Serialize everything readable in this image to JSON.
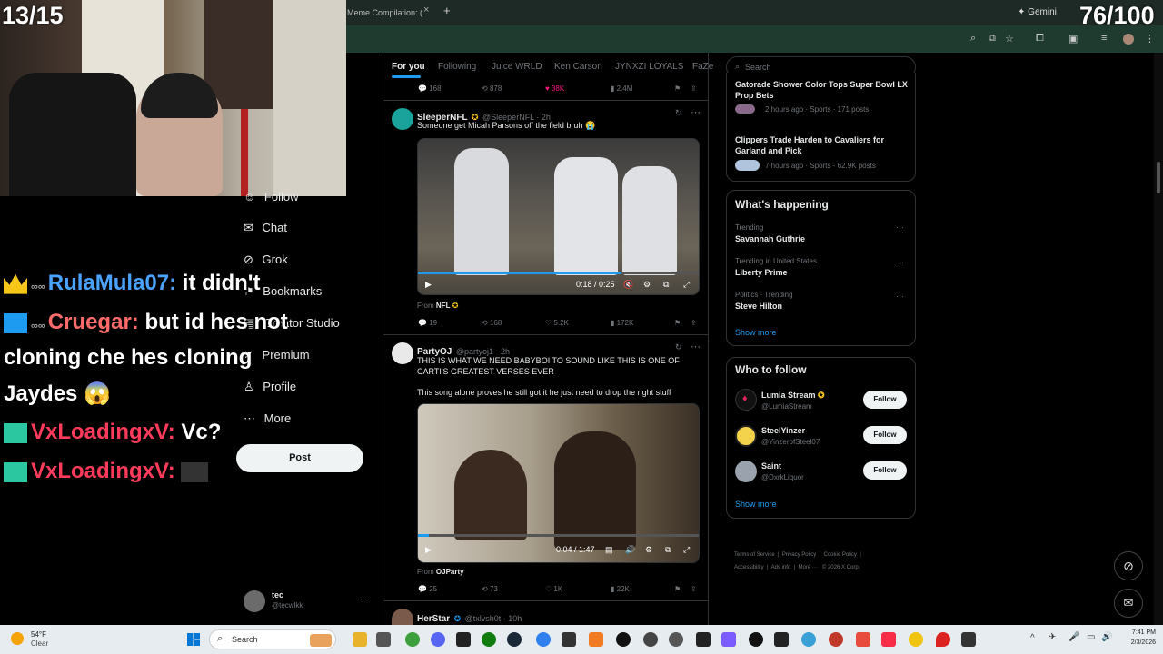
{
  "overlay": {
    "left_counter": "13/15",
    "right_counter": "76/100"
  },
  "browser": {
    "tab_title": "Meme Compilation: (",
    "tab_close": "×",
    "new_tab": "+",
    "gemini": "Gemini"
  },
  "left_nav": {
    "items": [
      {
        "label": "Follow",
        "icon": "follow-icon"
      },
      {
        "label": "Chat",
        "icon": "chat-icon"
      },
      {
        "label": "Grok",
        "icon": "grok-icon"
      },
      {
        "label": "Bookmarks",
        "icon": "bookmark-icon"
      },
      {
        "label": "Creator Studio",
        "icon": "studio-icon"
      },
      {
        "label": "Premium",
        "icon": "premium-icon"
      },
      {
        "label": "Profile",
        "icon": "profile-icon"
      },
      {
        "label": "More",
        "icon": "more-icon"
      }
    ],
    "post_label": "Post",
    "account": {
      "name": "tec",
      "handle": "@tecwlkk",
      "menu": "···"
    }
  },
  "chat": [
    {
      "user": "RulaMula07:",
      "message": "it didn't",
      "user_color": "#4aa3ff"
    },
    {
      "user": "Cruegar:",
      "message": "but id hes not",
      "user_color": "#ff6b6b"
    },
    {
      "continuation": "cloning che hes cloning"
    },
    {
      "continuation": "Jaydes 😱"
    },
    {
      "user": "VxLoadingxV:",
      "message": "Vc?",
      "user_color": "#ff3b5c"
    },
    {
      "user": "VxLoadingxV:",
      "message": "",
      "user_color": "#ff3b5c"
    }
  ],
  "timeline": {
    "tabs": [
      "For you",
      "Following",
      "Juice WRLD",
      "Ken Carson",
      "JYNXZI LOYALS",
      "FaZe"
    ],
    "top_stats": {
      "replies": "168",
      "reposts": "878",
      "likes": "38K",
      "views": "2.4M"
    },
    "posts": [
      {
        "name": "SleeperNFL",
        "handle": "@SleeperNFL · 2h",
        "text": "Someone get Micah Parsons off the field bruh 😭",
        "video_time": "0:18 / 0:25",
        "from_label": "From",
        "from": "NFL",
        "stats": {
          "replies": "19",
          "reposts": "168",
          "likes": "5.2K",
          "views": "172K"
        }
      },
      {
        "name": "PartyOJ",
        "handle": "@partyoj1 · 2h",
        "text": "THIS IS WHAT WE NEED BABYBOI TO SOUND LIKE THIS IS ONE OF CARTI'S GREATEST VERSES EVER",
        "text2": "This song alone proves he still got it he just need to drop the right stuff",
        "video_time": "0:04 / 1:47",
        "from_label": "From",
        "from": "OJParty",
        "stats": {
          "replies": "25",
          "reposts": "73",
          "likes": "1K",
          "views": "22K"
        }
      },
      {
        "name": "HerStar",
        "handle": "@txlvsh0t · 10h"
      }
    ]
  },
  "sidebar": {
    "search_placeholder": "Search",
    "news": [
      {
        "title": "Gatorade Shower Color Tops Super Bowl LX Prop Bets",
        "meta": "2 hours ago · Sports · 171 posts"
      },
      {
        "title": "Clippers Trade Harden to Cavaliers for Garland and Pick",
        "meta": "7 hours ago · Sports · 62.9K posts"
      }
    ],
    "whats_happening": {
      "title": "What's happening",
      "trends": [
        {
          "context": "Trending",
          "name": "Savannah Guthrie"
        },
        {
          "context": "Trending in United States",
          "name": "Liberty Prime"
        },
        {
          "context": "Politics · Trending",
          "name": "Steve Hilton"
        }
      ],
      "show_more": "Show more"
    },
    "who_to_follow": {
      "title": "Who to follow",
      "accounts": [
        {
          "name": "Lumia Stream",
          "handle": "@LumiaStream"
        },
        {
          "name": "SteelYinzer",
          "handle": "@YinzerofSteel07"
        },
        {
          "name": "Saint",
          "handle": "@DxrkLiquor"
        }
      ],
      "follow_label": "Follow",
      "show_more": "Show more"
    },
    "footer": [
      "Terms of Service",
      "Privacy Policy",
      "Cookie Policy",
      "Accessibility",
      "Ads info",
      "More ···",
      "© 2026 X Corp."
    ]
  },
  "taskbar": {
    "weather_temp": "54°F",
    "weather_desc": "Clear",
    "search": "Search",
    "time": "7:41 PM",
    "date": "2/3/2026"
  }
}
